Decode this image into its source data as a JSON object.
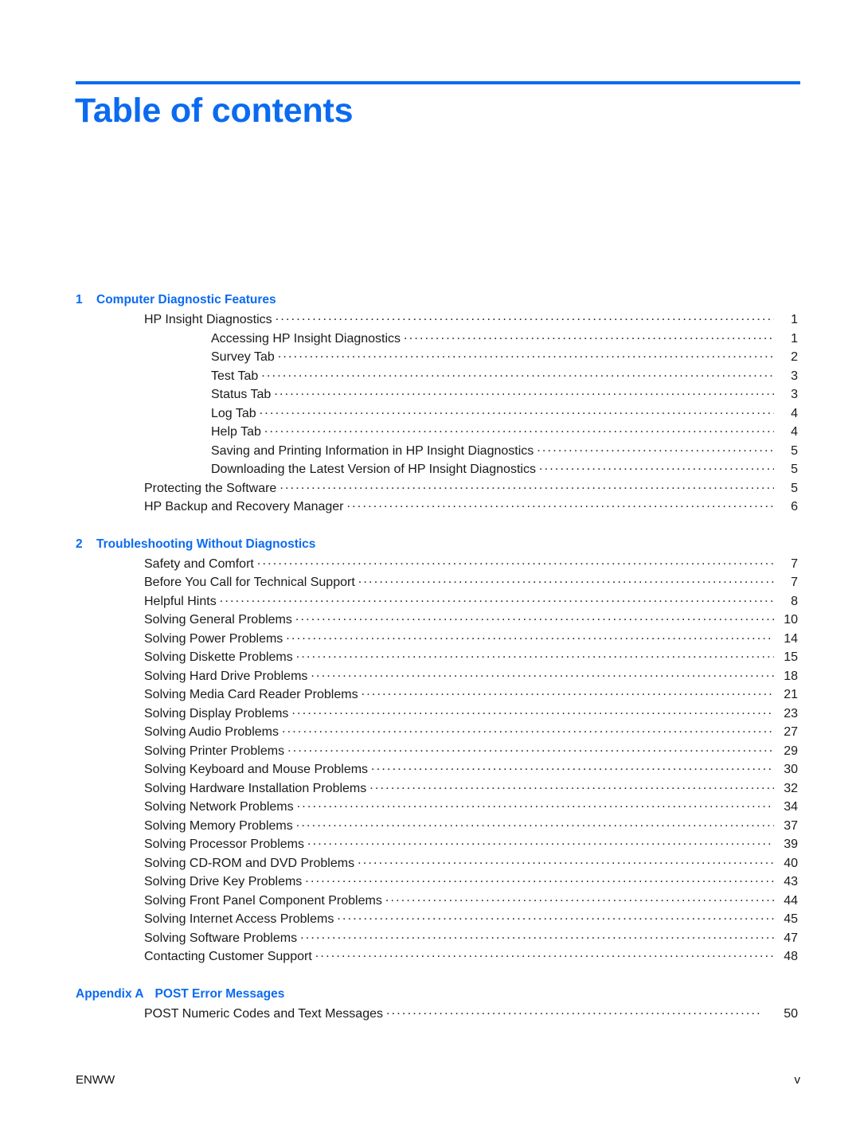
{
  "document": {
    "title": "Table of contents",
    "accent_color": "#0b6bf0"
  },
  "footer": {
    "left": "ENWW",
    "right": "v"
  },
  "toc": {
    "chapters": [
      {
        "number": "1",
        "title": "Computer Diagnostic Features",
        "entries": [
          {
            "level": 1,
            "label": "HP Insight Diagnostics",
            "page": "1"
          },
          {
            "level": 2,
            "label": "Accessing HP Insight Diagnostics",
            "page": "1"
          },
          {
            "level": 2,
            "label": "Survey Tab",
            "page": "2"
          },
          {
            "level": 2,
            "label": "Test Tab",
            "page": "3"
          },
          {
            "level": 2,
            "label": "Status Tab",
            "page": "3"
          },
          {
            "level": 2,
            "label": "Log Tab",
            "page": "4"
          },
          {
            "level": 2,
            "label": "Help Tab",
            "page": "4"
          },
          {
            "level": 2,
            "label": "Saving and Printing Information in HP Insight Diagnostics",
            "page": "5"
          },
          {
            "level": 2,
            "label": "Downloading the Latest Version of HP Insight Diagnostics",
            "page": "5"
          },
          {
            "level": 1,
            "label": "Protecting the Software",
            "page": "5"
          },
          {
            "level": 1,
            "label": "HP Backup and Recovery Manager",
            "page": "6"
          }
        ]
      },
      {
        "number": "2",
        "title": "Troubleshooting Without Diagnostics",
        "entries": [
          {
            "level": 1,
            "label": "Safety and Comfort",
            "page": "7"
          },
          {
            "level": 1,
            "label": "Before You Call for Technical Support",
            "page": "7"
          },
          {
            "level": 1,
            "label": "Helpful Hints",
            "page": "8"
          },
          {
            "level": 1,
            "label": "Solving General Problems",
            "page": "10"
          },
          {
            "level": 1,
            "label": "Solving Power Problems",
            "page": "14"
          },
          {
            "level": 1,
            "label": "Solving Diskette Problems",
            "page": "15"
          },
          {
            "level": 1,
            "label": "Solving Hard Drive Problems",
            "page": "18"
          },
          {
            "level": 1,
            "label": "Solving Media Card Reader Problems",
            "page": "21"
          },
          {
            "level": 1,
            "label": "Solving Display Problems",
            "page": "23"
          },
          {
            "level": 1,
            "label": "Solving Audio Problems",
            "page": "27"
          },
          {
            "level": 1,
            "label": "Solving Printer Problems",
            "page": "29"
          },
          {
            "level": 1,
            "label": "Solving Keyboard and Mouse Problems",
            "page": "30"
          },
          {
            "level": 1,
            "label": "Solving Hardware Installation Problems",
            "page": "32"
          },
          {
            "level": 1,
            "label": "Solving Network Problems",
            "page": "34"
          },
          {
            "level": 1,
            "label": "Solving Memory Problems",
            "page": "37"
          },
          {
            "level": 1,
            "label": "Solving Processor Problems",
            "page": "39"
          },
          {
            "level": 1,
            "label": "Solving CD-ROM and DVD Problems",
            "page": "40"
          },
          {
            "level": 1,
            "label": "Solving Drive Key Problems",
            "page": "43"
          },
          {
            "level": 1,
            "label": "Solving Front Panel Component Problems",
            "page": "44"
          },
          {
            "level": 1,
            "label": "Solving Internet Access Problems",
            "page": "45"
          },
          {
            "level": 1,
            "label": "Solving Software Problems",
            "page": "47"
          },
          {
            "level": 1,
            "label": "Contacting Customer Support",
            "page": "48"
          }
        ]
      },
      {
        "number": "Appendix A",
        "title": "POST Error Messages",
        "is_appendix": true,
        "entries": [
          {
            "level": 1,
            "label": "POST Numeric Codes and Text Messages",
            "page": "50",
            "wide_gap": true
          }
        ]
      }
    ]
  }
}
